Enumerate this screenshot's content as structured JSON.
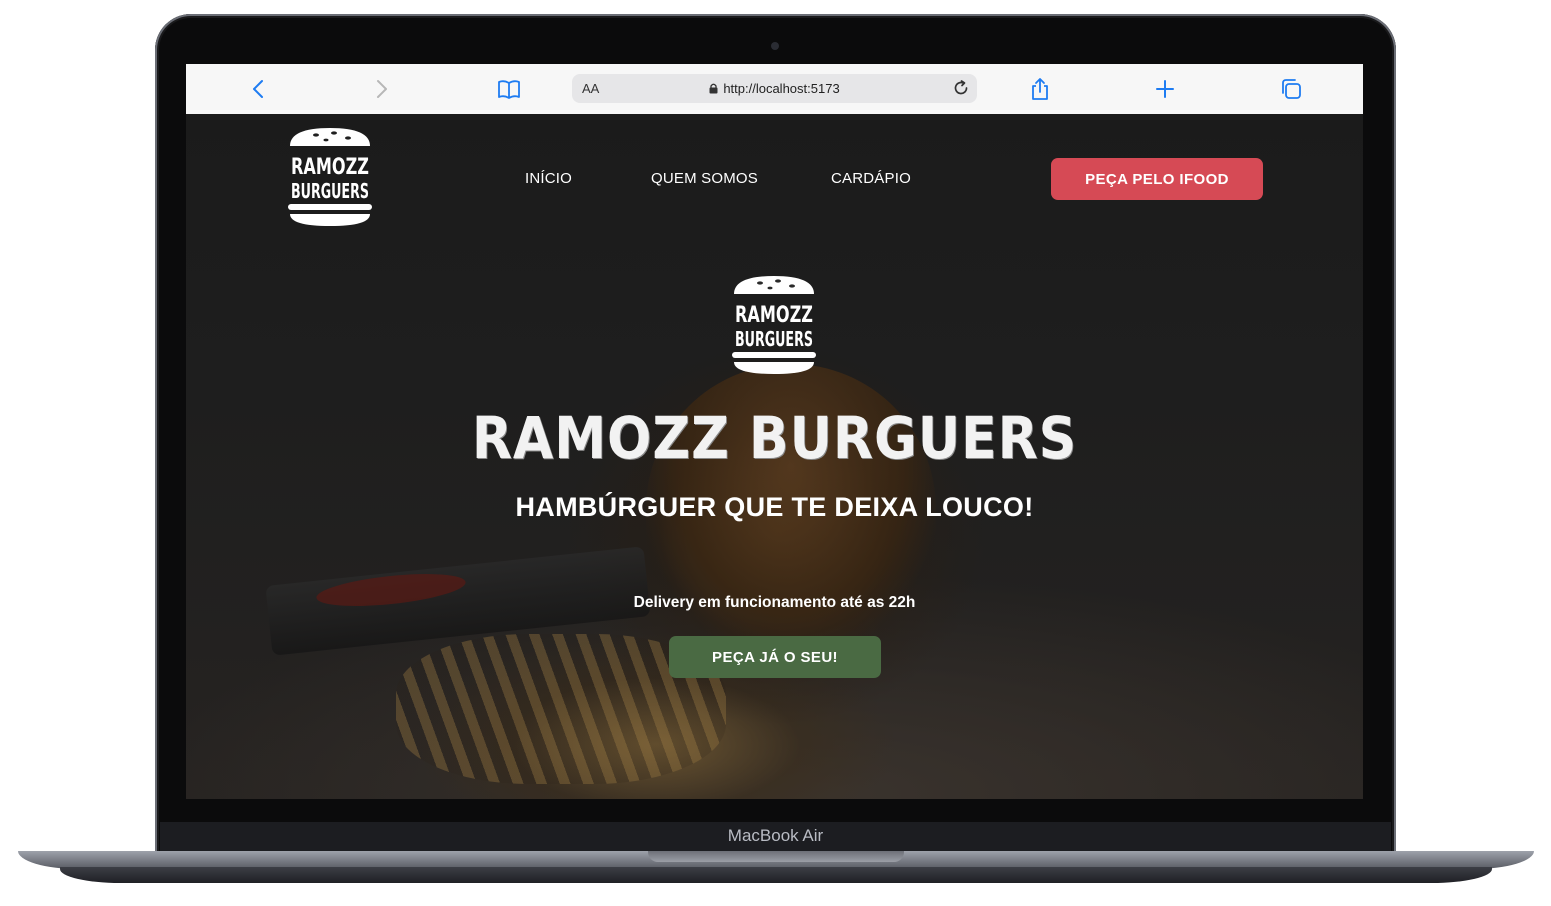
{
  "device": {
    "label": "MacBook Air"
  },
  "browser": {
    "reader_label": "AA",
    "url": "http://localhost:5173"
  },
  "site": {
    "logo": {
      "line1": "RAMOZZ",
      "line2": "BURGUERS"
    },
    "nav": [
      {
        "label": "INÍCIO"
      },
      {
        "label": "QUEM SOMOS"
      },
      {
        "label": "CARDÁPIO"
      }
    ],
    "ifood_button": "PEÇA PELO IFOOD",
    "hero": {
      "title": "RAMOZZ BURGUERS",
      "subtitle": "HAMBÚRGUER QUE TE DEIXA LOUCO!",
      "info": "Delivery em funcionamento até as 22h",
      "order_button": "PEÇA JÁ O SEU!"
    }
  },
  "colors": {
    "ifood_button": "#d64a55",
    "order_button": "#4a6a43",
    "browser_accent": "#1e7cf2"
  }
}
